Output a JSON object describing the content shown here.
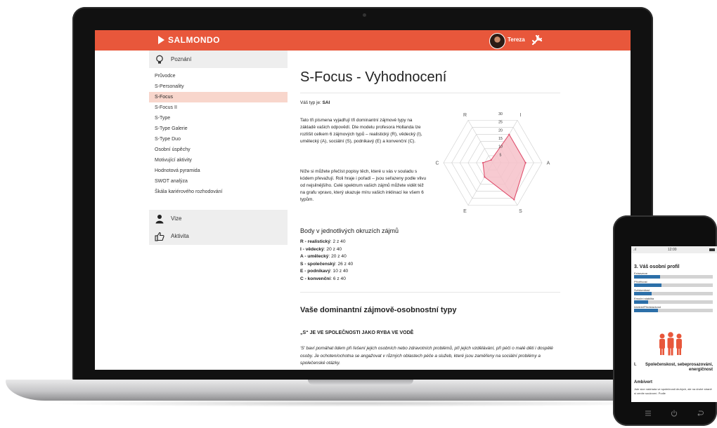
{
  "app": {
    "brand": "SALMONDO",
    "user_name": "Tereza",
    "accent": "#e8573b"
  },
  "sidebar": {
    "sections": [
      {
        "label": "Poznání",
        "icon": "lightbulb-icon"
      },
      {
        "label": "Vize",
        "icon": "person-icon"
      },
      {
        "label": "Aktivita",
        "icon": "thumbs-up-icon"
      }
    ],
    "items": [
      {
        "label": "Průvodce"
      },
      {
        "label": "S-Personality"
      },
      {
        "label": "S-Focus",
        "active": true
      },
      {
        "label": "S-Focus II"
      },
      {
        "label": "S-Type"
      },
      {
        "label": "S-Type Galerie"
      },
      {
        "label": "S-Type Duo"
      },
      {
        "label": "Osobní úspěchy"
      },
      {
        "label": "Motivující aktivity"
      },
      {
        "label": "Hodnotová pyramida"
      },
      {
        "label": "SWOT analýza"
      },
      {
        "label": "Škála kariérového rozhodování"
      }
    ]
  },
  "main": {
    "title": "S-Focus - Vyhodnocení",
    "type_prefix": "Váš typ je: ",
    "type_value": "SAI",
    "paragraph1": "Tato tři písmena vyjadřují tři dominantní zájmové typy na základě vašich odpovědí. Dle modelu profesora Hollanda lze rozlišit celkem 6 zájmových typů – realistický (R), vědecký (I), umělecký (A), sociální (S), podnikavý (E) a konvenční (C).",
    "paragraph2": "Níže si můžete přečíst popisy těch, které u vás v souladu s kódem převažují. Roli hraje i pořadí – jsou seřazeny podle vlivu od nejsilnějšího. Celé spektrum vašich zájmů můžete vidět též na grafu vpravo, který ukazuje míru vašich inklinací ke všem 6 typům.",
    "scores_title": "Body v jednotlivých okruzích zájmů",
    "scores": [
      {
        "name": "R - realistický",
        "value": ": 2 z 40"
      },
      {
        "name": "I - vědecký",
        "value": ": 20 z 40"
      },
      {
        "name": "A - umělecký",
        "value": ": 20 z 40"
      },
      {
        "name": "S - společenský",
        "value": ": 26 z 40"
      },
      {
        "name": "E - podnikavý",
        "value": ": 10 z 40"
      },
      {
        "name": "C - konvenční",
        "value": ": 6 z 40"
      }
    ],
    "section_heading": "Vaše dominantní zájmově-osobnostní typy",
    "subheading": "„S“ JE VE SPOLEČNOSTI JAKO RYBA VE VODĚ",
    "italic_text": "‘S’ baví pomáhat lidem při řešení jejich osobních nebo zdravotních problémů, při jejich vzdělávání, při péči o malé děti i dospělé osoby. Je ochoten/ochotna se angažovat v různých oblastech péče a služeb, které jsou zaměřeny na sociální problémy a společenské otázky."
  },
  "chart_data": {
    "type": "radar",
    "axes": [
      "R",
      "I",
      "A",
      "S",
      "E",
      "C"
    ],
    "values": [
      2,
      20,
      20,
      26,
      10,
      6
    ],
    "rmax": 30,
    "ticks": [
      5,
      10,
      15,
      20,
      25,
      30
    ],
    "fill_color": "#f6c1c9",
    "line_color": "#e0506e",
    "grid_color": "#cccccc"
  },
  "phone": {
    "status_time": "12:00",
    "status_signal": ".ıl",
    "title": "3. Váš osobní profil",
    "bars": [
      {
        "label": "Extraverze",
        "value": 0.33
      },
      {
        "label": "Přívětivost",
        "value": 0.35
      },
      {
        "label": "Svědomitost",
        "value": 0.22
      },
      {
        "label": "Emoční stabilita",
        "value": 0.18
      },
      {
        "label": "Intelekt/Představivost",
        "value": 0.3
      }
    ],
    "profile_num": "I.",
    "profile_text": "Společenskost, sebeprosazování, energičnost",
    "sub_title": "Ambivert",
    "body": "Jste sice nádriada ve společnosti druhých, ale na druhé straně si ceníte soukromí. Podle"
  }
}
